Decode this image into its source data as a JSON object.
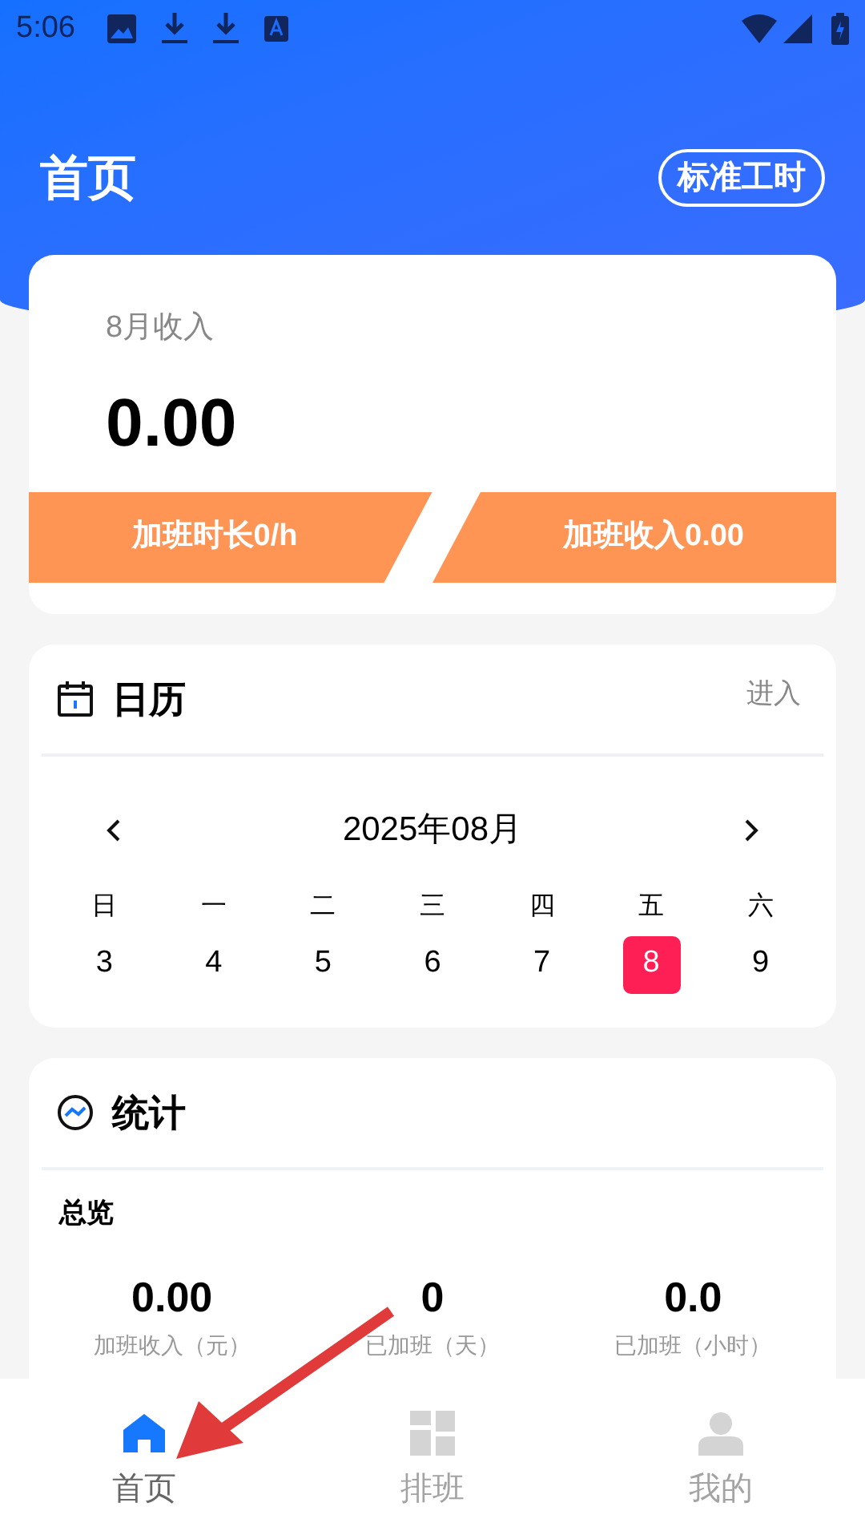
{
  "status_bar": {
    "time": "5:06"
  },
  "header": {
    "title": "首页",
    "action": "标准工时"
  },
  "income_card": {
    "label": "8月收入",
    "amount": "0.00",
    "buttons": [
      "加班时长0/h",
      "加班收入0.00"
    ]
  },
  "calendar": {
    "title": "日历",
    "link": "进入",
    "month": "2025年08月",
    "weekdays": [
      "日",
      "一",
      "二",
      "三",
      "四",
      "五",
      "六"
    ],
    "days": [
      {
        "label": "3",
        "selected": false
      },
      {
        "label": "4",
        "selected": false
      },
      {
        "label": "5",
        "selected": false
      },
      {
        "label": "6",
        "selected": false
      },
      {
        "label": "7",
        "selected": false
      },
      {
        "label": "8",
        "selected": true
      },
      {
        "label": "9",
        "selected": false
      }
    ]
  },
  "stats": {
    "title": "统计",
    "section": "总览",
    "items": [
      {
        "value": "0.00",
        "label": "加班收入（元）"
      },
      {
        "value": "0",
        "label": "已加班（天）"
      },
      {
        "value": "0.0",
        "label": "已加班（小时）"
      }
    ]
  },
  "tab_bar": [
    {
      "label": "首页",
      "kind": "home",
      "selected": true
    },
    {
      "label": "排班",
      "kind": "schedule",
      "selected": false
    },
    {
      "label": "我的",
      "kind": "profile",
      "selected": false
    }
  ]
}
